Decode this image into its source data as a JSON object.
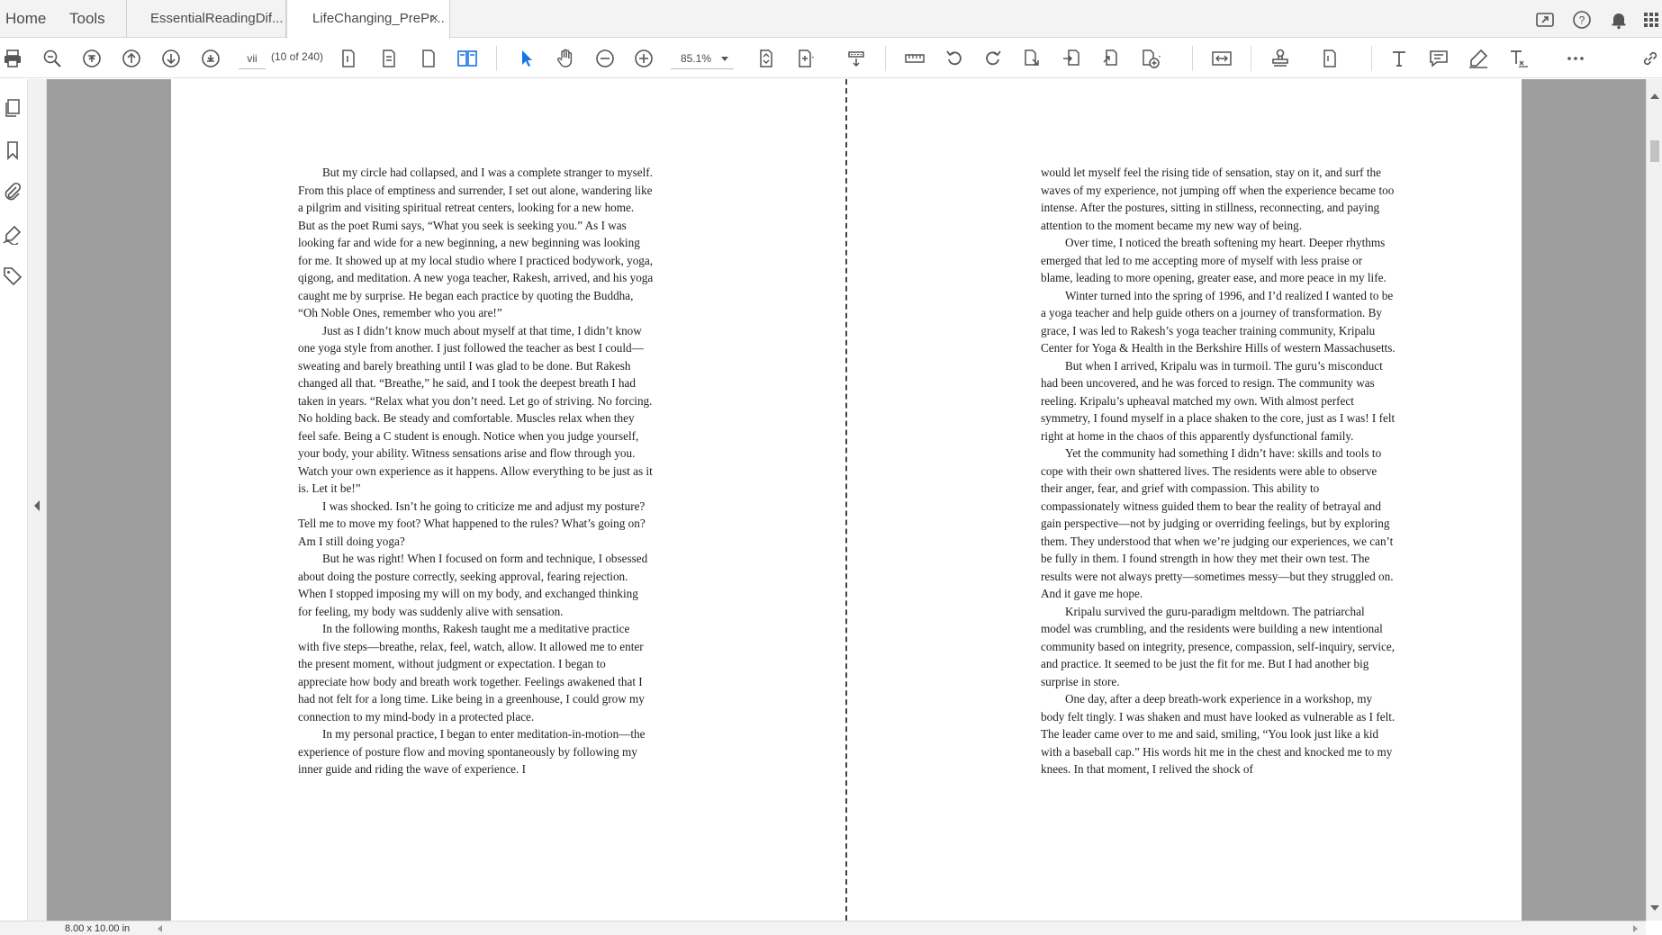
{
  "tabbar": {
    "home": "Home",
    "tools": "Tools",
    "tabs": [
      {
        "label": "EssentialReadingDif..."
      },
      {
        "label": "LifeChanging_PrePr..."
      }
    ],
    "close_symbol": "×"
  },
  "toolbar": {
    "page_number": "vii",
    "page_count": "(10 of 240)",
    "zoom": "85.1%",
    "icons": [
      "print-icon",
      "zoom-out-search-icon",
      "first-page-icon",
      "prev-page-icon",
      "next-page-icon",
      "last-page-icon",
      "single-page-icon",
      "scroll-page-icon",
      "page-icon",
      "two-page-icon",
      "select-arrow-icon",
      "hand-icon",
      "zoom-out-icon",
      "zoom-in-icon",
      "fit-page-icon",
      "marquee-zoom-icon",
      "scroll-mode-icon",
      "measure-icon",
      "rotate-left-icon",
      "rotate-right-icon",
      "extract-icon",
      "insert-icon",
      "replace-icon",
      "create-icon",
      "compare-icon",
      "stamp-icon",
      "attach-file-icon",
      "text-tool-icon",
      "comment-icon",
      "highlight-icon",
      "text-edit-icon",
      "more-icon",
      "link-icon"
    ]
  },
  "leftrail": {
    "icons": [
      "pages-panel-icon",
      "bookmark-icon",
      "attachment-icon",
      "signature-icon",
      "tags-icon"
    ]
  },
  "statusbar": {
    "page_size": "8.00 x 10.00 in"
  },
  "document": {
    "left_paragraphs": [
      "But my circle had collapsed, and I was a complete stranger to myself. From this place of emptiness and surrender, I set out alone, wandering like a pilgrim and visiting spiritual retreat centers, looking for a new home. But as the poet Rumi says, “What you seek is seeking you.” As I was looking far and wide for a new beginning, a new beginning was looking for me. It showed up at my local studio where I practiced bodywork, yoga, qigong, and meditation. A new yoga teacher, Rakesh, arrived, and his yoga caught me by surprise. He began each practice by quoting the Buddha, “Oh Noble Ones, remember who you are!”",
      "Just as I didn’t know much about myself at that time, I didn’t know one yoga style from another. I just followed the teacher as best I could—sweating and barely breathing until I was glad to be done. But Rakesh changed all that. “Breathe,” he said, and I took the deepest breath I had taken in years. “Relax what you don’t need. Let go of striving. No forcing. No holding back. Be steady and comfortable. Muscles relax when they feel safe. Being a C student is enough. Notice when you judge yourself, your body, your ability. Witness sensations arise and flow through you. Watch your own experience as it happens. Allow everything to be just as it is. Let it be!”",
      "I was shocked. Isn’t he going to criticize me and adjust my posture? Tell me to move my foot? What happened to the rules? What’s going on? Am I still doing yoga?",
      "But he was right! When I focused on form and technique, I obsessed about doing the posture correctly, seeking approval, fearing rejection. When I stopped imposing my will on my body, and exchanged thinking for feeling, my body was suddenly alive with sensation.",
      "In the following months, Rakesh taught me a meditative practice with five steps—breathe, relax, feel, watch, allow. It allowed me to enter the present moment, without judgment or expectation. I began to appreciate how body and breath work together. Feelings awakened that I had not felt for a long time. Like being in a greenhouse, I could grow my connection to my mind-body in a protected place.",
      "In my personal practice, I began to enter meditation-in-motion—the experience of posture flow and moving spontaneously by following my inner guide and riding the wave of experience. I"
    ],
    "right_paragraphs": [
      "would let myself feel the rising tide of sensation, stay on it, and surf the waves of my experience, not jumping off when the experience became too intense. After the postures, sitting in stillness, reconnecting, and paying attention to the moment became my new way of being.",
      "Over time, I noticed the breath softening my heart. Deeper rhythms emerged that led to me accepting more of myself with less praise or blame, leading to more opening, greater ease, and more peace in my life.",
      "Winter turned into the spring of 1996, and I’d realized I wanted to be a yoga teacher and help guide others on a journey of transformation. By grace, I was led to Rakesh’s yoga teacher training community, Kripalu Center for Yoga & Health in the Berkshire Hills of western Massachusetts.",
      "But when I arrived, Kripalu was in turmoil. The guru’s misconduct had been uncovered, and he was forced to resign. The community was reeling. Kripalu’s upheaval matched my own. With almost perfect symmetry, I found myself in a place shaken to the core, just as I was! I felt right at home in the chaos of this apparently dysfunctional family.",
      "Yet the community had something I didn’t have: skills and tools to cope with their own shattered lives. The residents were able to observe their anger, fear, and grief with compassion. This ability to compassionately witness guided them to bear the reality of betrayal and gain perspective—not by judging or overriding feelings, but by exploring them. They understood that when we’re judging our experiences, we can’t be fully in them. I found strength in how they met their own test. The results were not always pretty—sometimes messy—but they struggled on. And it gave me hope.",
      "Kripalu survived the guru-paradigm meltdown. The patriarchal model was crumbling, and the residents were building a new intentional community based on integrity, presence, compassion, self-inquiry, service, and practice. It seemed to be just the fit for me. But I had another big surprise in store.",
      "One day, after a deep breath-work experience in a workshop, my body felt tingly. I was shaken and must have looked as vulnerable as I felt. The leader came over to me and said, smiling, “You look just like a kid with a baseball cap.” His words hit me in the chest and knocked me to my knees. In that moment, I relived the shock of"
    ]
  }
}
